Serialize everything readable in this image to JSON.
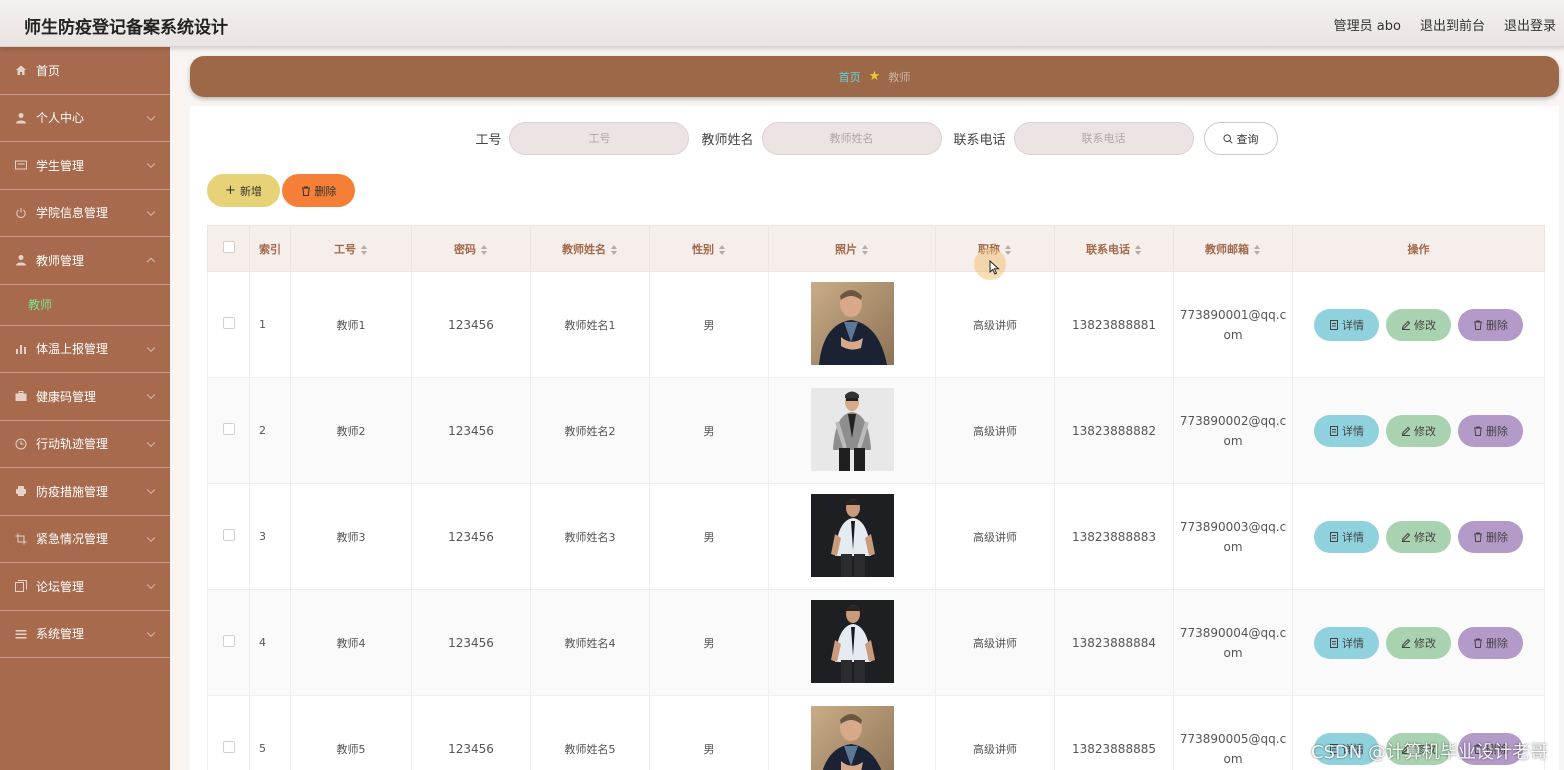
{
  "header": {
    "title": "师生防疫登记备案系统设计",
    "admin": "管理员 abo",
    "to_front": "退出到前台",
    "logout": "退出登录"
  },
  "sidebar": {
    "items": [
      {
        "label": "首页",
        "icon": "home-icon"
      },
      {
        "label": "个人中心",
        "icon": "user-icon"
      },
      {
        "label": "学生管理",
        "icon": "card-icon"
      },
      {
        "label": "学院信息管理",
        "icon": "power-icon"
      },
      {
        "label": "教师管理",
        "icon": "user-icon",
        "expanded": true,
        "children": [
          "教师"
        ]
      },
      {
        "label": "体温上报管理",
        "icon": "bar-chart-icon"
      },
      {
        "label": "健康码管理",
        "icon": "briefcase-icon"
      },
      {
        "label": "行动轨迹管理",
        "icon": "clock-icon"
      },
      {
        "label": "防疫措施管理",
        "icon": "printer-icon"
      },
      {
        "label": "紧急情况管理",
        "icon": "crop-icon"
      },
      {
        "label": "论坛管理",
        "icon": "copy-icon"
      },
      {
        "label": "系统管理",
        "icon": "list-icon"
      }
    ],
    "active_color": "#7fe38f"
  },
  "breadcrumb": {
    "home": "首页",
    "current": "教师"
  },
  "search": {
    "fields": [
      {
        "label": "工号",
        "placeholder": "工号"
      },
      {
        "label": "教师姓名",
        "placeholder": "教师姓名"
      },
      {
        "label": "联系电话",
        "placeholder": "联系电话"
      }
    ],
    "query_label": "查询"
  },
  "actions": {
    "add_label": "新增",
    "delete_label": "删除"
  },
  "table": {
    "columns": [
      "索引",
      "工号",
      "密码",
      "教师姓名",
      "性别",
      "照片",
      "职称",
      "联系电话",
      "教师邮箱",
      "操作"
    ],
    "row_buttons": {
      "detail": "详情",
      "edit": "修改",
      "remove": "删除"
    },
    "rows": [
      {
        "index": "1",
        "id": "教师1",
        "password": "123456",
        "name": "教师姓名1",
        "gender": "男",
        "photo": "man-in-dark-suit",
        "title": "高级讲师",
        "phone": "13823888881",
        "email_line1": "773890001@qq.c",
        "email_line2": "om"
      },
      {
        "index": "2",
        "id": "教师2",
        "password": "123456",
        "name": "教师姓名2",
        "gender": "男",
        "photo": "man-in-grey-jacket",
        "title": "高级讲师",
        "phone": "13823888882",
        "email_line1": "773890002@qq.c",
        "email_line2": "om"
      },
      {
        "index": "3",
        "id": "教师3",
        "password": "123456",
        "name": "教师姓名3",
        "gender": "男",
        "photo": "man-in-white-shirt",
        "title": "高级讲师",
        "phone": "13823888883",
        "email_line1": "773890003@qq.c",
        "email_line2": "om"
      },
      {
        "index": "4",
        "id": "教师4",
        "password": "123456",
        "name": "教师姓名4",
        "gender": "男",
        "photo": "man-in-white-shirt",
        "title": "高级讲师",
        "phone": "13823888884",
        "email_line1": "773890004@qq.c",
        "email_line2": "om"
      },
      {
        "index": "5",
        "id": "教师5",
        "password": "123456",
        "name": "教师姓名5",
        "gender": "男",
        "photo": "man-in-dark-suit",
        "title": "高级讲师",
        "phone": "13823888885",
        "email_line1": "773890005@qq.c",
        "email_line2": "om"
      }
    ]
  },
  "watermark": "CSDN @计算机毕业设计老哥",
  "colors": {
    "sidebar": "#a76a4c",
    "breadcrumb": "#9d6847",
    "header_text": "#a3694b",
    "add": "#e8d277",
    "delete": "#f67f38",
    "detail": "#8fd2dd",
    "edit": "#a9d3b0",
    "remove": "#b39ac8"
  }
}
